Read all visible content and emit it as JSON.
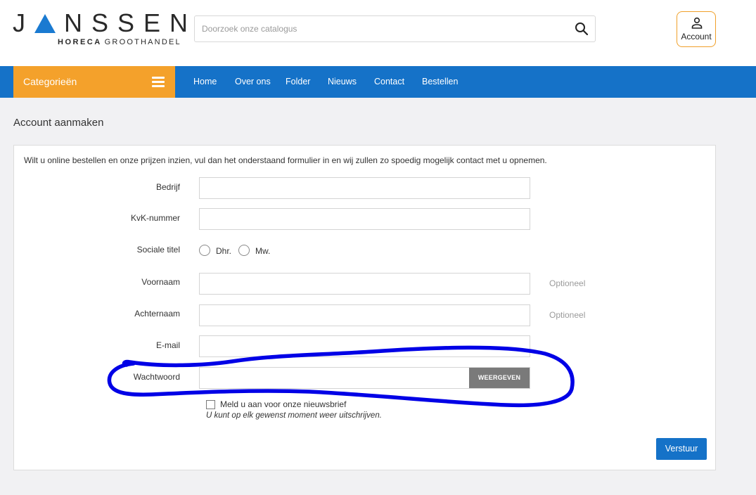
{
  "header": {
    "logo_main": "JANSSEN",
    "logo_sub_bold": "HORECA",
    "logo_sub": "GROOTHANDEL",
    "search_placeholder": "Doorzoek onze catalogus",
    "account_label": "Account"
  },
  "nav": {
    "categories_label": "Categorieën",
    "links": [
      "Home",
      "Over ons",
      "Folder",
      "Nieuws",
      "Contact",
      "Bestellen"
    ]
  },
  "page": {
    "title": "Account aanmaken",
    "intro": "Wilt u online bestellen en onze prijzen inzien, vul dan het onderstaand formulier in en wij zullen zo spoedig mogelijk contact met u opnemen."
  },
  "form": {
    "company_label": "Bedrijf",
    "kvk_label": "KvK-nummer",
    "title_label": "Sociale titel",
    "title_options": [
      "Dhr.",
      "Mw."
    ],
    "firstname_label": "Voornaam",
    "lastname_label": "Achternaam",
    "optional_text": "Optioneel",
    "email_label": "E-mail",
    "password_label": "Wachtwoord",
    "show_password_label": "WEERGEVEN",
    "newsletter_label": "Meld u aan voor onze nieuwsbrief",
    "unsubscribe_note": "U kunt op elk gewenst moment weer uitschrijven.",
    "submit_label": "Verstuur"
  },
  "colors": {
    "brand_blue": "#1572c8",
    "brand_orange": "#f4a12b",
    "annotation_blue": "#0000e6"
  },
  "icons": {
    "search": "magnifier-icon",
    "account": "user-icon",
    "menu": "hamburger-icon"
  }
}
